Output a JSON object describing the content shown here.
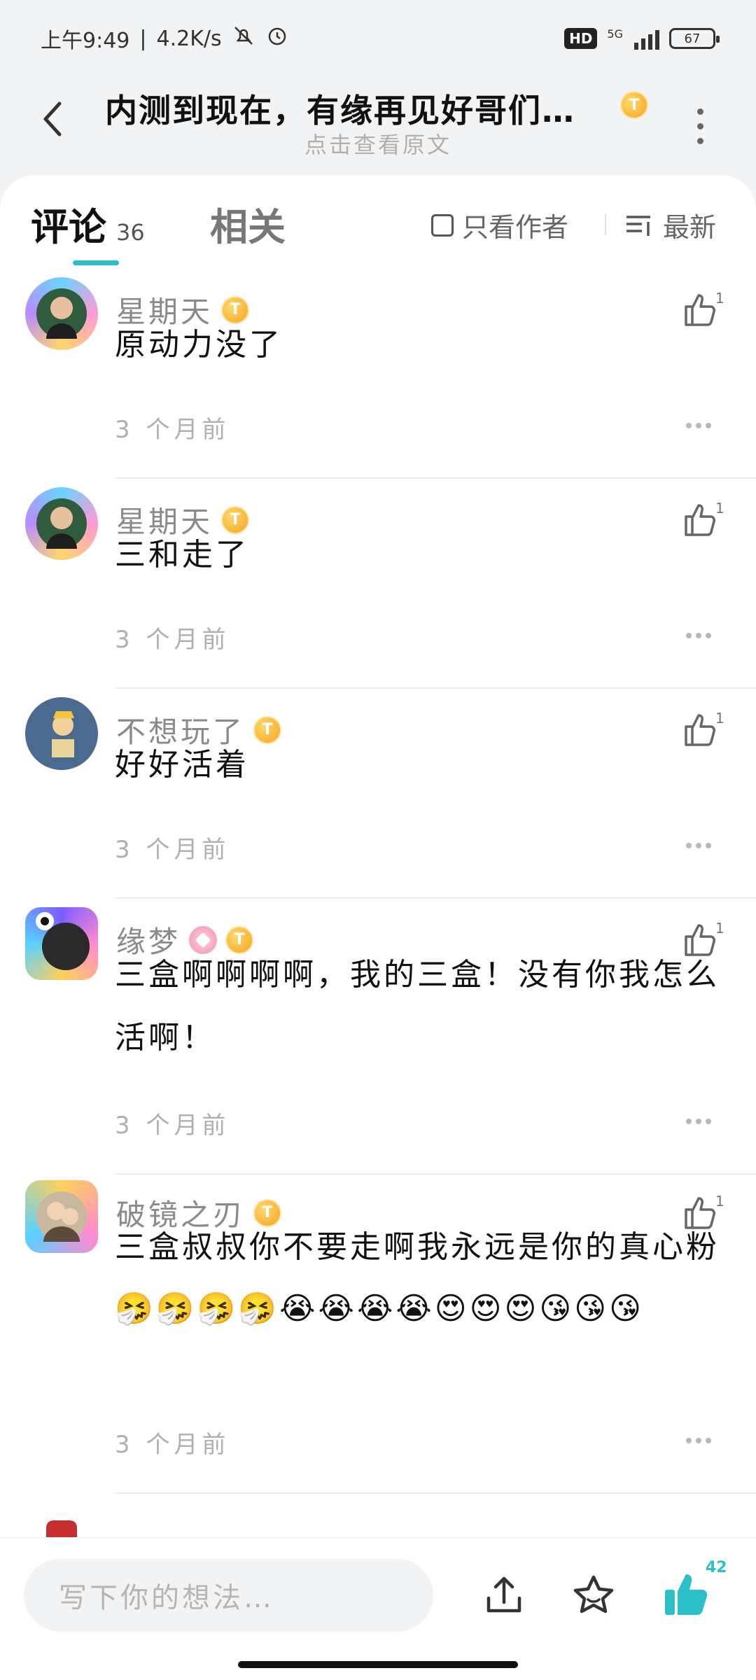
{
  "status_bar": {
    "time": "上午9:49",
    "net_speed": "4.2K/s",
    "hd": "HD",
    "signal_label": "5G",
    "battery": "67"
  },
  "header": {
    "title": "内测到现在，有缘再见好哥们…",
    "subtitle": "点击查看原文"
  },
  "tabs": {
    "comments_label": "评论",
    "comments_count": "36",
    "related_label": "相关",
    "author_only_label": "只看作者",
    "sort_label": "最新"
  },
  "comments": [
    {
      "user": "星期天",
      "text": "原动力没了",
      "time": "3 个月前",
      "likes": "1"
    },
    {
      "user": "星期天",
      "text": "三和走了",
      "time": "3 个月前",
      "likes": "1"
    },
    {
      "user": "不想玩了",
      "text": "好好活着",
      "time": "3 个月前",
      "likes": "1"
    },
    {
      "user": "缘梦",
      "text": "三盒啊啊啊啊，我的三盒！没有你我怎么活啊！",
      "time": "3 个月前",
      "likes": "1"
    },
    {
      "user": "破镜之刃",
      "text": "三盒叔叔你不要走啊我永远是你的真心粉🤧🤧🤧🤧😭😭😭😭😍😍😍😘😘😘",
      "time": "3 个月前",
      "likes": "1"
    }
  ],
  "bottom": {
    "input_placeholder": "写下你的想法…",
    "like_count": "42"
  },
  "colors": {
    "accent": "#2bc0c9",
    "badge_gold": "#f5a623"
  },
  "icons": [
    "back-icon",
    "more-vertical-icon",
    "sort-icon",
    "like-icon",
    "share-icon",
    "star-icon",
    "thumbs-up-icon"
  ]
}
